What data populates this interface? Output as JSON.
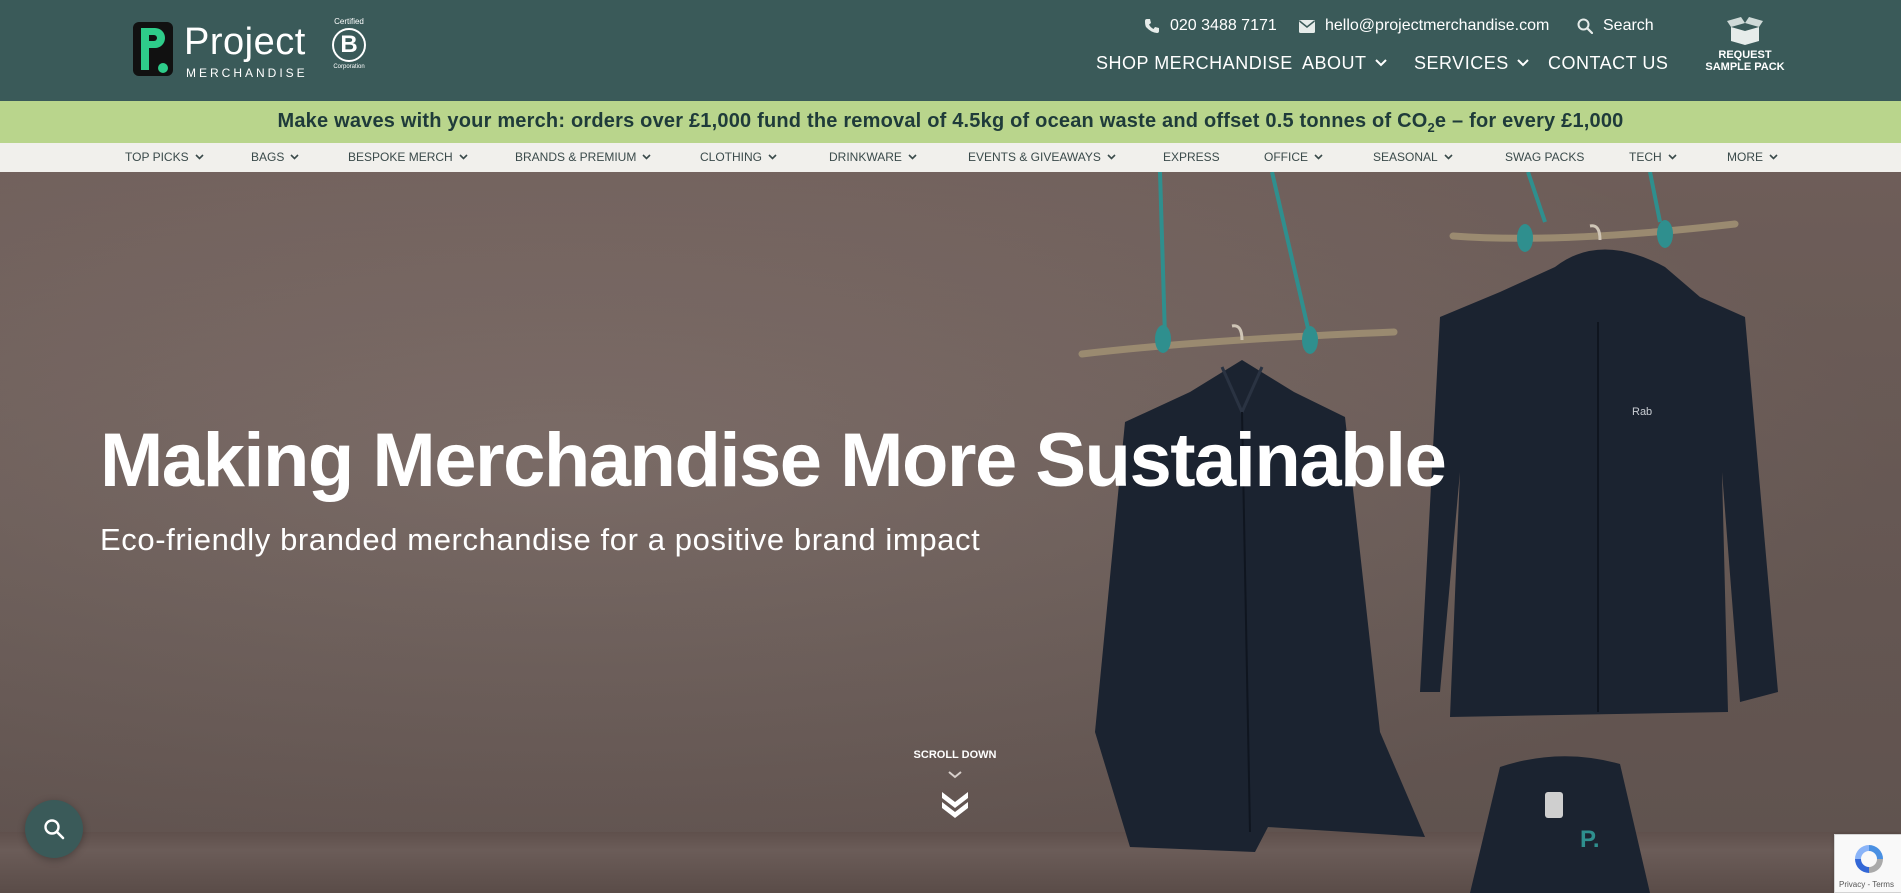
{
  "header": {
    "logo_word": "Project",
    "logo_sub": "MERCHANDISE",
    "bcorp_certified": "Certified",
    "bcorp_letter": "B",
    "bcorp_corp": "Corporation",
    "phone": "020 3488 7171",
    "email": "hello@projectmerchandise.com",
    "search_label": "Search",
    "nav": {
      "shop": "SHOP MERCHANDISE",
      "about": "ABOUT",
      "services": "SERVICES",
      "contact": "CONTACT US"
    },
    "sample_line1": "REQUEST",
    "sample_line2": "SAMPLE PACK"
  },
  "promo": {
    "text_before": "Make waves with your merch: orders over £1,000 fund the removal of 4.5kg of ocean waste and offset 0.5 tonnes of CO",
    "subscript": "2",
    "text_after": "e – for every £1,000"
  },
  "categories": {
    "top_picks": "TOP PICKS",
    "bags": "BAGS",
    "bespoke": "BESPOKE MERCH",
    "brands": "BRANDS & PREMIUM",
    "clothing": "CLOTHING",
    "drinkware": "DRINKWARE",
    "events": "EVENTS & GIVEAWAYS",
    "express": "EXPRESS",
    "office": "OFFICE",
    "seasonal": "SEASONAL",
    "swag": "SWAG PACKS",
    "tech": "TECH",
    "more": "MORE"
  },
  "hero": {
    "title": "Making Merchandise More Sustainable",
    "subtitle": "Eco-friendly branded merchandise for a positive brand impact",
    "scroll_label": "SCROLL DOWN",
    "jacket_brand": "Rab"
  },
  "recaptcha": {
    "terms": "Privacy - Terms"
  },
  "colors": {
    "header_bg": "#3a5a59",
    "promo_bg": "#b9d58c",
    "catbar_bg": "#f1f0ec",
    "logo_accent": "#2ecc8a"
  },
  "icons": {
    "phone": "phone-icon",
    "email": "envelope-icon",
    "search": "search-icon",
    "sample": "box-icon",
    "chevron": "chevron-down-icon",
    "scroll": "double-chevron-icon"
  }
}
